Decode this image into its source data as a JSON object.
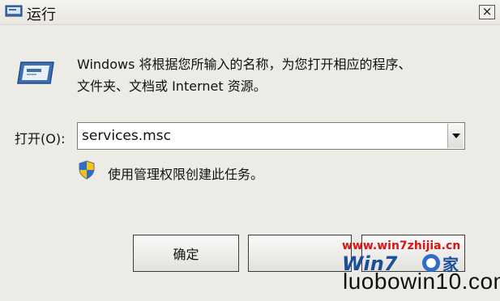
{
  "window": {
    "title": "运行",
    "close_label": "×"
  },
  "dialog": {
    "description_line1": "Windows 将根据您所输入的名称，为您打开相应的程序、",
    "description_line2": "文件夹、文档或 Internet 资源。",
    "open_label": "打开(O):",
    "command_value": "services.msc",
    "admin_note": "使用管理权限创建此任务。"
  },
  "buttons": {
    "ok_label": "确定",
    "cancel_label": "",
    "browse_label": ""
  },
  "watermark": {
    "url": "www.win7zhijia.cn",
    "site": "luobowin10.com"
  },
  "icons": {
    "title": "run-icon",
    "app": "run-icon",
    "shield": "shield-icon",
    "dropdown": "chevron-down-icon"
  }
}
